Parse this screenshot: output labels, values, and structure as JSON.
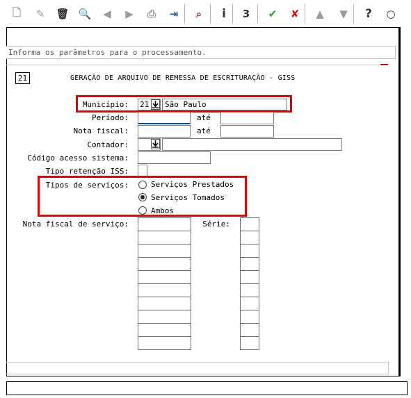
{
  "toolbar": {
    "buttons": [
      {
        "name": "new-doc-icon",
        "glyph": "🗋"
      },
      {
        "name": "edit-icon",
        "glyph": "✎"
      },
      {
        "name": "trash-icon",
        "glyph": "🗑"
      },
      {
        "name": "search-icon",
        "glyph": "🔍"
      },
      {
        "name": "back-icon",
        "glyph": "◀"
      },
      {
        "name": "forward-icon",
        "glyph": "▶"
      },
      {
        "name": "print-icon",
        "glyph": "⎙"
      },
      {
        "name": "exit-icon",
        "glyph": "⇥"
      },
      {
        "name": "binoculars-icon",
        "glyph": "⌕"
      },
      {
        "name": "info-icon",
        "glyph": "i"
      },
      {
        "name": "calculator-icon",
        "glyph": "3"
      },
      {
        "name": "confirm-icon",
        "glyph": "✔"
      },
      {
        "name": "cancel-icon",
        "glyph": "✘"
      },
      {
        "name": "up-icon",
        "glyph": "▲"
      },
      {
        "name": "down-icon",
        "glyph": "▼"
      },
      {
        "name": "help-icon",
        "glyph": "?"
      },
      {
        "name": "chat-icon",
        "glyph": "○"
      }
    ]
  },
  "info_text": "Informa os parâmetros para o processamento.",
  "screen_number": "21",
  "title": "GERAÇÃO DE ARQUIVO DE REMESSA DE ESCRITURAÇÃO - GISS",
  "form": {
    "municipio_label": "Município:",
    "municipio_code": "21",
    "municipio_name": "São Paulo",
    "periodo_label": "Período:",
    "ate_label": "até",
    "nota_fiscal_label": "Nota fiscal:",
    "contador_label": "Contador:",
    "codigo_acesso_label": "Código acesso sistema:",
    "tipo_retencao_label": "Tipo retenção ISS:",
    "tipos_servicos_label": "Tipos de serviços:",
    "radio_options": [
      "Serviços Prestados",
      "Serviços Tomados",
      "Ambos"
    ],
    "selected_radio": "Serviços Tomados",
    "nota_fiscal_servico_label": "Nota fiscal de serviço:",
    "serie_label": "Série:"
  },
  "colors": {
    "highlight_border": "#e00000",
    "confirm": "#2a9a2a",
    "cancel": "#cc1111"
  }
}
